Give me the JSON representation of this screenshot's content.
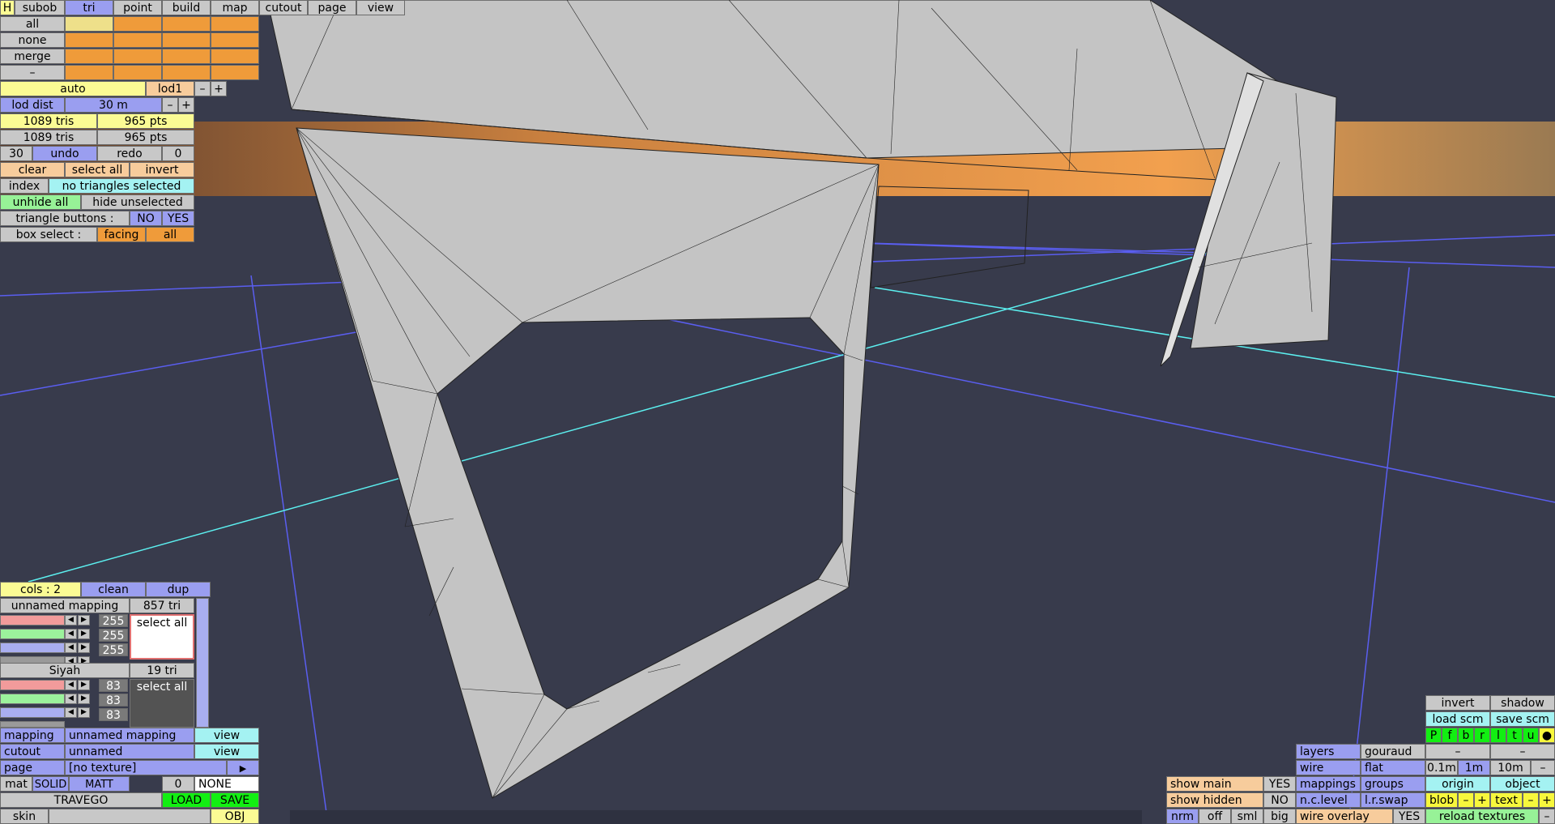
{
  "menu": {
    "tabs": [
      "H",
      "subob",
      "tri",
      "point",
      "build",
      "map",
      "cutout",
      "page",
      "view"
    ],
    "active": "tri"
  },
  "select_panel": {
    "rows": [
      "all",
      "none",
      "merge",
      "–"
    ]
  },
  "lod": {
    "mode": "auto",
    "level": "lod1",
    "minus": "–",
    "plus": "+",
    "dist_label": "lod dist",
    "dist_value": "30 m"
  },
  "stats": {
    "tris_1": "1089 tris",
    "pts_1": "965 pts",
    "tris_2": "1089 tris",
    "pts_2": "965 pts"
  },
  "history": {
    "count": "30",
    "undo": "undo",
    "redo": "redo",
    "pos": "0"
  },
  "selection": {
    "clear": "clear",
    "select_all": "select all",
    "invert": "invert",
    "index": "index",
    "status": "no triangles selected",
    "unhide_all": "unhide all",
    "hide_unselected": "hide unselected"
  },
  "triangle_buttons": {
    "label": "triangle buttons :",
    "no": "NO",
    "yes": "YES"
  },
  "box_select": {
    "label": "box select :",
    "facing": "facing",
    "all": "all"
  },
  "colors_panel": {
    "cols": "cols : 2",
    "clean": "clean",
    "dup": "dup",
    "groups": [
      {
        "name": "unnamed mapping",
        "count": "857 tri",
        "r": "255",
        "g": "255",
        "b": "255",
        "select": "select all"
      },
      {
        "name": "Siyah",
        "count": "19 tri",
        "r": "83",
        "g": "83",
        "b": "83",
        "select": "select all"
      }
    ]
  },
  "properties": {
    "mapping_label": "mapping",
    "mapping_value": "unnamed mapping",
    "mapping_view": "view",
    "cutout_label": "cutout",
    "cutout_value": "unnamed",
    "cutout_view": "view",
    "page_label": "page",
    "page_value": "[no texture]",
    "page_arrow": "▶",
    "mat_label": "mat",
    "mat_solid": "SOLID",
    "mat_matt": "MATT",
    "mat_num": "0",
    "mat_none": "NONE",
    "project": "TRAVEGO",
    "load": "LOAD",
    "save": "SAVE",
    "skin_label": "skin",
    "obj": "OBJ"
  },
  "view_panel": {
    "invert": "invert",
    "shadow": "shadow",
    "load_scm": "load scm",
    "save_scm": "save scm",
    "flags": [
      "P",
      "f",
      "b",
      "r",
      "l",
      "t",
      "u",
      "●"
    ],
    "layers": "layers",
    "gouraud": "gouraud",
    "dash1": "–",
    "dash2": "–",
    "wire": "wire",
    "flat": "flat",
    "scale_01": "0.1m",
    "scale_1": "1m",
    "scale_10": "10m",
    "scale_minus": "–",
    "show_main": "show main",
    "show_main_val": "YES",
    "mappings": "mappings",
    "groups": "groups",
    "origin": "origin",
    "object": "object",
    "show_hidden": "show hidden",
    "show_hidden_val": "NO",
    "nc_level": "n.c.level",
    "lr_swap": "l.r.swap",
    "blob": "blob",
    "blob_minus": "–",
    "blob_plus": "+",
    "text": "text",
    "text_minus": "–",
    "text_plus": "+",
    "nrm": "nrm",
    "off": "off",
    "sml": "sml",
    "big": "big",
    "wire_overlay": "wire overlay",
    "wire_overlay_val": "YES",
    "reload_textures": "reload textures",
    "reload_minus": "–"
  },
  "colors": {
    "viewport_bg": "#383b4c",
    "horizon": "#f0a050",
    "grid": "#5a5ef0",
    "axis": "#5cf0f0",
    "mesh": "#c4c4c4"
  }
}
